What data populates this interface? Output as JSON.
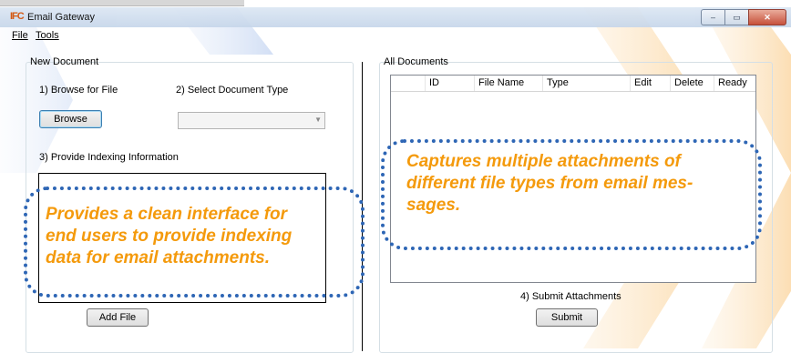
{
  "window": {
    "icon_text": "IFC",
    "title": "Email Gateway",
    "controls": {
      "minimize": "–",
      "maximize": "▭",
      "close": "✕"
    }
  },
  "menu": {
    "file": "File",
    "tools": "Tools"
  },
  "new_document": {
    "legend": "New Document",
    "step1_label": "1) Browse for File",
    "step2_label": "2) Select Document Type",
    "browse_button": "Browse",
    "doc_type_value": "",
    "step3_label": "3) Provide Indexing Information",
    "add_file_button": "Add File"
  },
  "all_documents": {
    "legend": "All Documents",
    "columns": [
      "ID",
      "File Name",
      "Type",
      "Edit",
      "Delete",
      "Ready"
    ],
    "rows": [],
    "step4_label": "4) Submit Attachments",
    "submit_button": "Submit"
  },
  "callouts": {
    "left": [
      "Provides a clean interface for",
      "end users to provide indexing",
      "data for email attachments."
    ],
    "right": [
      "Captures multiple attachments of",
      "different file types from email mes-",
      "sages."
    ]
  },
  "colors": {
    "callout_border": "#2e66b5",
    "callout_text": "#f49a0c",
    "accent_orange": "#f5a31a"
  }
}
